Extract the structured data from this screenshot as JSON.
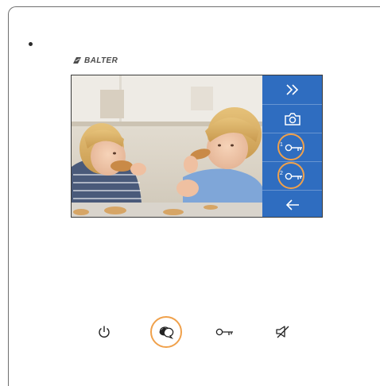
{
  "brand": {
    "name": "BALTER"
  },
  "screen": {
    "buttons": [
      {
        "id": "expand",
        "icon": "double-chevron-right-icon",
        "highlighted": false
      },
      {
        "id": "snapshot",
        "icon": "camera-icon",
        "highlighted": false
      },
      {
        "id": "unlock-1",
        "icon": "key-icon",
        "number": "1",
        "highlighted": true
      },
      {
        "id": "unlock-2",
        "icon": "key-icon",
        "number": "2",
        "highlighted": true
      },
      {
        "id": "back",
        "icon": "arrow-left-icon",
        "highlighted": false
      }
    ],
    "panel_color": "#2f6dc0"
  },
  "hardware_buttons": [
    {
      "id": "power",
      "icon": "power-icon",
      "highlighted": false
    },
    {
      "id": "talk",
      "icon": "speech-bubble-icon",
      "highlighted": true
    },
    {
      "id": "unlock",
      "icon": "key-icon",
      "highlighted": false
    },
    {
      "id": "mute",
      "icon": "speaker-mute-icon",
      "highlighted": false
    }
  ],
  "highlight_color": "#f0a14b"
}
